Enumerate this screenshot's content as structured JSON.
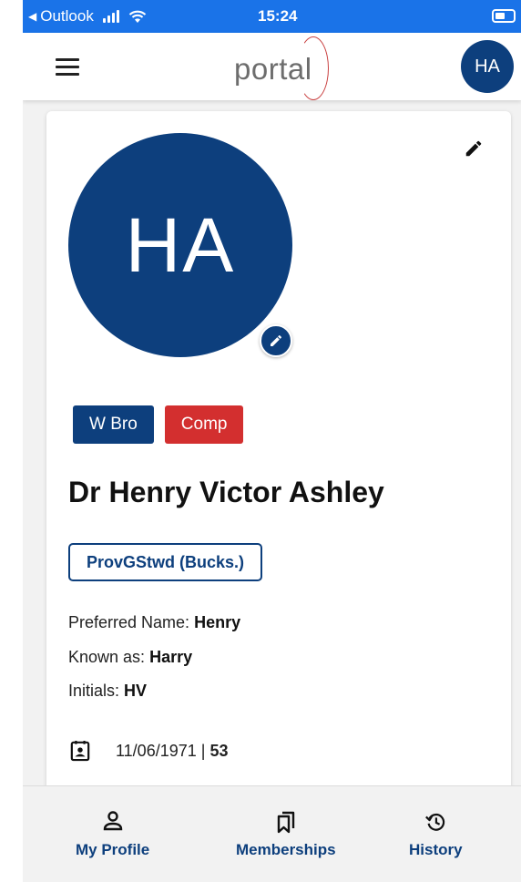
{
  "status_bar": {
    "back_label": "Outlook",
    "time": "15:24"
  },
  "header": {
    "brand": "portal",
    "avatar_initials": "HA"
  },
  "profile": {
    "initials": "HA",
    "badges": [
      "W Bro",
      "Comp"
    ],
    "full_name": "Dr Henry Victor Ashley",
    "office": "ProvGStwd (Bucks.)",
    "preferred_name_label": "Preferred Name:",
    "preferred_name": "Henry",
    "known_as_label": "Known as:",
    "known_as": "Harry",
    "initials_label": "Initials:",
    "initials_value": "HV",
    "dob": "11/06/1971 |",
    "age": "53"
  },
  "bottom_nav": {
    "items": [
      {
        "label": "My Profile"
      },
      {
        "label": "Memberships"
      },
      {
        "label": "History"
      }
    ]
  },
  "colors": {
    "primary": "#0d3f7d",
    "accent_red": "#d32f2f",
    "status_bar": "#1a73e8"
  },
  "icons": {
    "menu": "menu-icon",
    "edit": "pencil-icon",
    "calendar": "calendar-user-icon",
    "profile": "person-icon",
    "memberships": "bookmarks-icon",
    "history": "history-icon"
  }
}
